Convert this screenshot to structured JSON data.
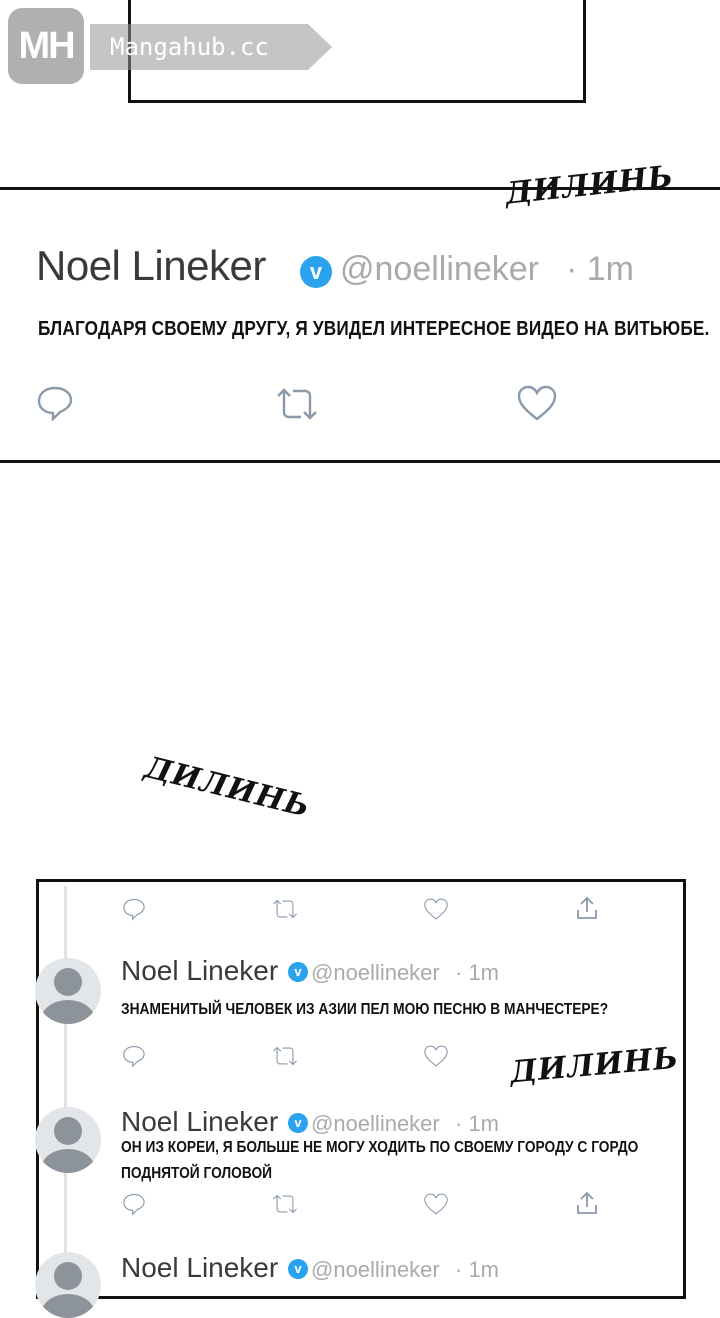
{
  "watermark": {
    "logo": "MH",
    "site": "Mangahub.cc"
  },
  "sfx": {
    "word": "ДИЛИНЬ"
  },
  "main_tweet": {
    "name": "Noel Lineker",
    "verified_mark": "v",
    "handle": "@noellineker",
    "time": "· 1m",
    "text": "БЛАГОДАРЯ СВОЕМУ ДРУГУ, Я УВИДЕЛ ИНТЕРЕСНОЕ ВИДЕО НА ВИТЬЮБЕ.",
    "actions": [
      "reply-icon",
      "retweet-icon",
      "like-icon"
    ]
  },
  "thread": {
    "tweets": [
      {
        "name": "Noel Lineker",
        "verified_mark": "v",
        "handle": "@noellineker",
        "time": "· 1m",
        "lines": [
          "ЗНАМЕНИТЫЙ ЧЕЛОВЕК ИЗ АЗИИ ПЕЛ МОЮ ПЕСНЮ В МАНЧЕСТЕРЕ?"
        ]
      },
      {
        "name": "Noel Lineker",
        "verified_mark": "v",
        "handle": "@noellineker",
        "time": "· 1m",
        "lines": [
          "ОН ИЗ КОРЕИ, Я БОЛЬШЕ НЕ МОГУ ХОДИТЬ ПО СВОЕМУ ГОРОДУ С ГОРДО",
          "ПОДНЯТОЙ ГОЛОВОЙ"
        ]
      },
      {
        "name": "Noel Lineker",
        "verified_mark": "v",
        "handle": "@noellineker",
        "time": "· 1m",
        "lines": []
      }
    ],
    "actions": [
      "reply-icon",
      "retweet-icon",
      "like-icon",
      "share-icon"
    ]
  },
  "colors": {
    "verified": "#2aa3ef",
    "icon": "#8a9aab",
    "meta": "#aaaaaa"
  }
}
